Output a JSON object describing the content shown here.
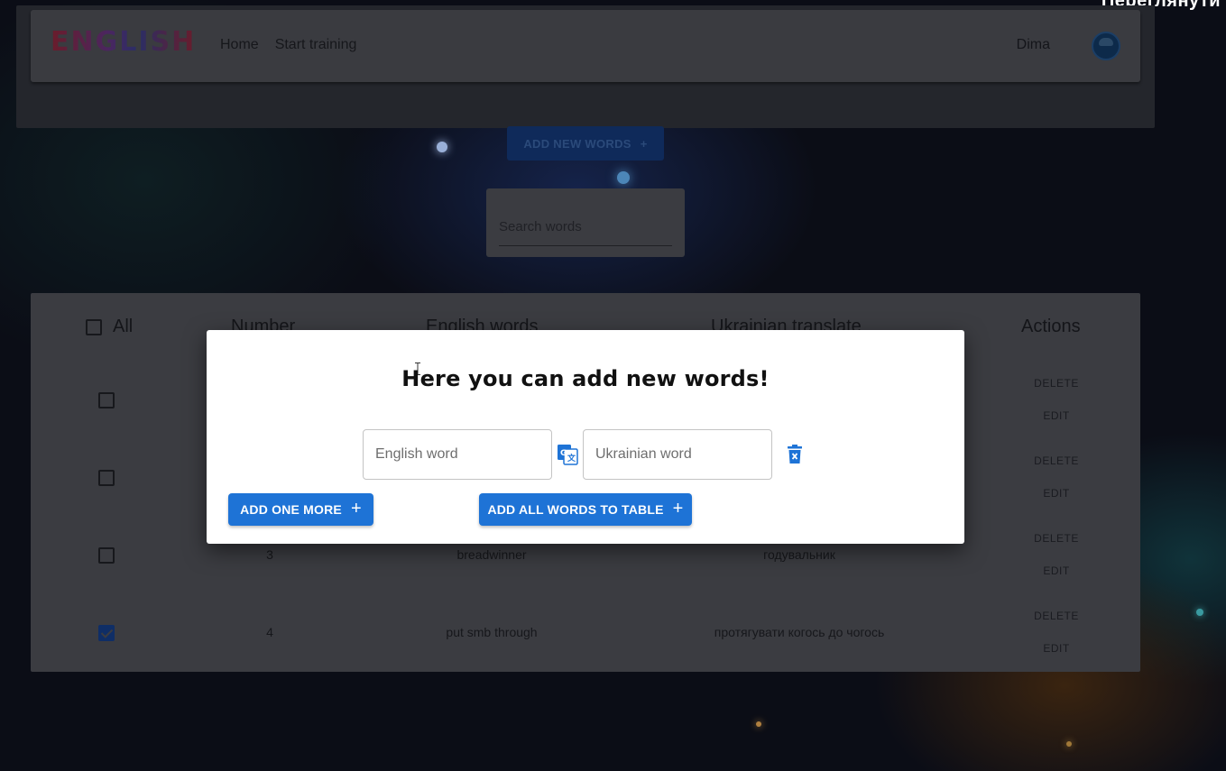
{
  "corner_text": "Переглянути",
  "header": {
    "logo": "ENGLISH",
    "nav": [
      "Home",
      "Start training"
    ],
    "user_name": "Dima"
  },
  "add_new_words_label": "ADD NEW WORDS",
  "search": {
    "placeholder": "Search words"
  },
  "table": {
    "headers": {
      "all": "All",
      "number": "Number",
      "english": "English words",
      "ukrainian": "Ukrainian translate",
      "actions": "Actions"
    },
    "rows": [
      {
        "number": "",
        "english": "",
        "ukrainian": "",
        "checked": false
      },
      {
        "number": "",
        "english": "",
        "ukrainian": "",
        "checked": false
      },
      {
        "number": "3",
        "english": "breadwinner",
        "ukrainian": "годувальник",
        "checked": false
      },
      {
        "number": "4",
        "english": "put smb through",
        "ukrainian": "протягувати когось до чогось",
        "checked": true
      }
    ],
    "delete_label": "DELETE",
    "edit_label": "EDIT"
  },
  "modal": {
    "title": "Here you can add new words!",
    "english_placeholder": "English word",
    "ukrainian_placeholder": "Ukrainian word",
    "add_one_more_label": "ADD ONE MORE",
    "add_all_label": "ADD ALL WORDS TO TABLE"
  },
  "colors": {
    "accent": "#1e73d6",
    "overlay_dim": "#3b3c41"
  }
}
